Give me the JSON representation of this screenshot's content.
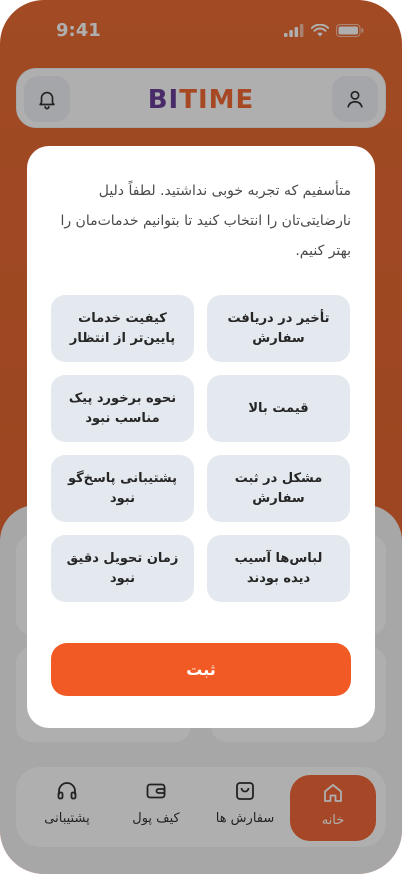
{
  "status_bar": {
    "time": "9:41"
  },
  "header": {
    "logo_part1": "BI",
    "logo_part2": "TIME"
  },
  "nav": {
    "items": [
      {
        "label": "خانه",
        "icon": "home-icon",
        "active": true
      },
      {
        "label": "سفارش ها",
        "icon": "shopping-bag-icon",
        "active": false
      },
      {
        "label": "کیف پول",
        "icon": "wallet-icon",
        "active": false
      },
      {
        "label": "پشتیبانی",
        "icon": "headset-icon",
        "active": false
      }
    ]
  },
  "modal": {
    "message": "متأسفیم که تجربه خوبی نداشتید. لطفاً دلیل نارضایتی‌تان را انتخاب کنید تا بتوانیم خدمات‌مان را بهتر کنیم.",
    "options": [
      "تأخیر در دریافت سفارش",
      "کیفیت خدمات پایین‌تر از انتظار",
      "قیمت بالا",
      "نحوه برخورد پیک مناسب نبود",
      "مشکل در ثبت سفارش",
      "پشتیبانی پاسخ‌گو نبود",
      "لباس‌ها آسیب دیده بودند",
      "زمان تحویل دقیق نبود"
    ],
    "submit_label": "ثبت"
  },
  "colors": {
    "accent": "#f15a24",
    "logo_purple": "#5b2a8e",
    "logo_orange": "#ef5a1d",
    "option_bg": "#e4e9ef"
  }
}
